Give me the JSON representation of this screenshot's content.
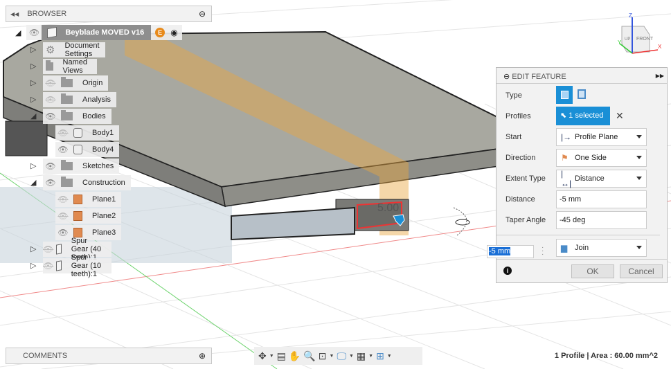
{
  "browser": {
    "title": "BROWSER",
    "root": {
      "label": "Beyblade MOVED v16",
      "badge": "E"
    },
    "items": [
      {
        "label": "Document Settings",
        "level": 1,
        "icon": "gear-icon",
        "expanded": false,
        "eye": "none"
      },
      {
        "label": "Named Views",
        "level": 1,
        "icon": "folder-icon",
        "expanded": false,
        "eye": "none"
      },
      {
        "label": "Origin",
        "level": 1,
        "icon": "folder-icon",
        "expanded": false,
        "eye": "hidden"
      },
      {
        "label": "Analysis",
        "level": 1,
        "icon": "folder-icon",
        "expanded": false,
        "eye": "hidden"
      },
      {
        "label": "Bodies",
        "level": 1,
        "icon": "folder-icon",
        "expanded": true,
        "eye": "visible"
      },
      {
        "label": "Body1",
        "level": 2,
        "icon": "body-icon",
        "eye": "hidden"
      },
      {
        "label": "Body4",
        "level": 2,
        "icon": "body-icon",
        "eye": "visible"
      },
      {
        "label": "Sketches",
        "level": 1,
        "icon": "folder-icon",
        "expanded": false,
        "eye": "visible"
      },
      {
        "label": "Construction",
        "level": 1,
        "icon": "folder-icon",
        "expanded": true,
        "eye": "visible"
      },
      {
        "label": "Plane1",
        "level": 2,
        "icon": "plane-icon",
        "eye": "hidden"
      },
      {
        "label": "Plane2",
        "level": 2,
        "icon": "plane-icon",
        "eye": "hidden"
      },
      {
        "label": "Plane3",
        "level": 2,
        "icon": "plane-icon",
        "eye": "visible"
      },
      {
        "label": "Spur Gear (40 teeth):1",
        "level": 0,
        "icon": "component-icon",
        "expanded": false,
        "eye": "hidden"
      },
      {
        "label": "Spur Gear (10 teeth):1",
        "level": 0,
        "icon": "component-icon",
        "expanded": false,
        "eye": "hidden"
      }
    ]
  },
  "comments": {
    "title": "COMMENTS"
  },
  "viewcube": {
    "top": "UP",
    "front": "FRONT",
    "axes": {
      "x": "X",
      "y": "Y",
      "z": "Z"
    }
  },
  "canvas": {
    "dimension_label": "5.00",
    "floating_input": "-5 mm"
  },
  "edit_feature": {
    "title": "EDIT FEATURE",
    "type_label": "Type",
    "profiles_label": "Profiles",
    "profiles_value": "1 selected",
    "start_label": "Start",
    "start_value": "Profile Plane",
    "direction_label": "Direction",
    "direction_value": "One Side",
    "extent_label": "Extent Type",
    "extent_value": "Distance",
    "distance_label": "Distance",
    "distance_value": "-5 mm",
    "taper_label": "Taper Angle",
    "taper_value": "-45 deg",
    "operation_value": "Join",
    "ok": "OK",
    "cancel": "Cancel",
    "accent": "#1a8fd6"
  },
  "status": {
    "text": "1 Profile | Area : 60.00 mm^2"
  }
}
